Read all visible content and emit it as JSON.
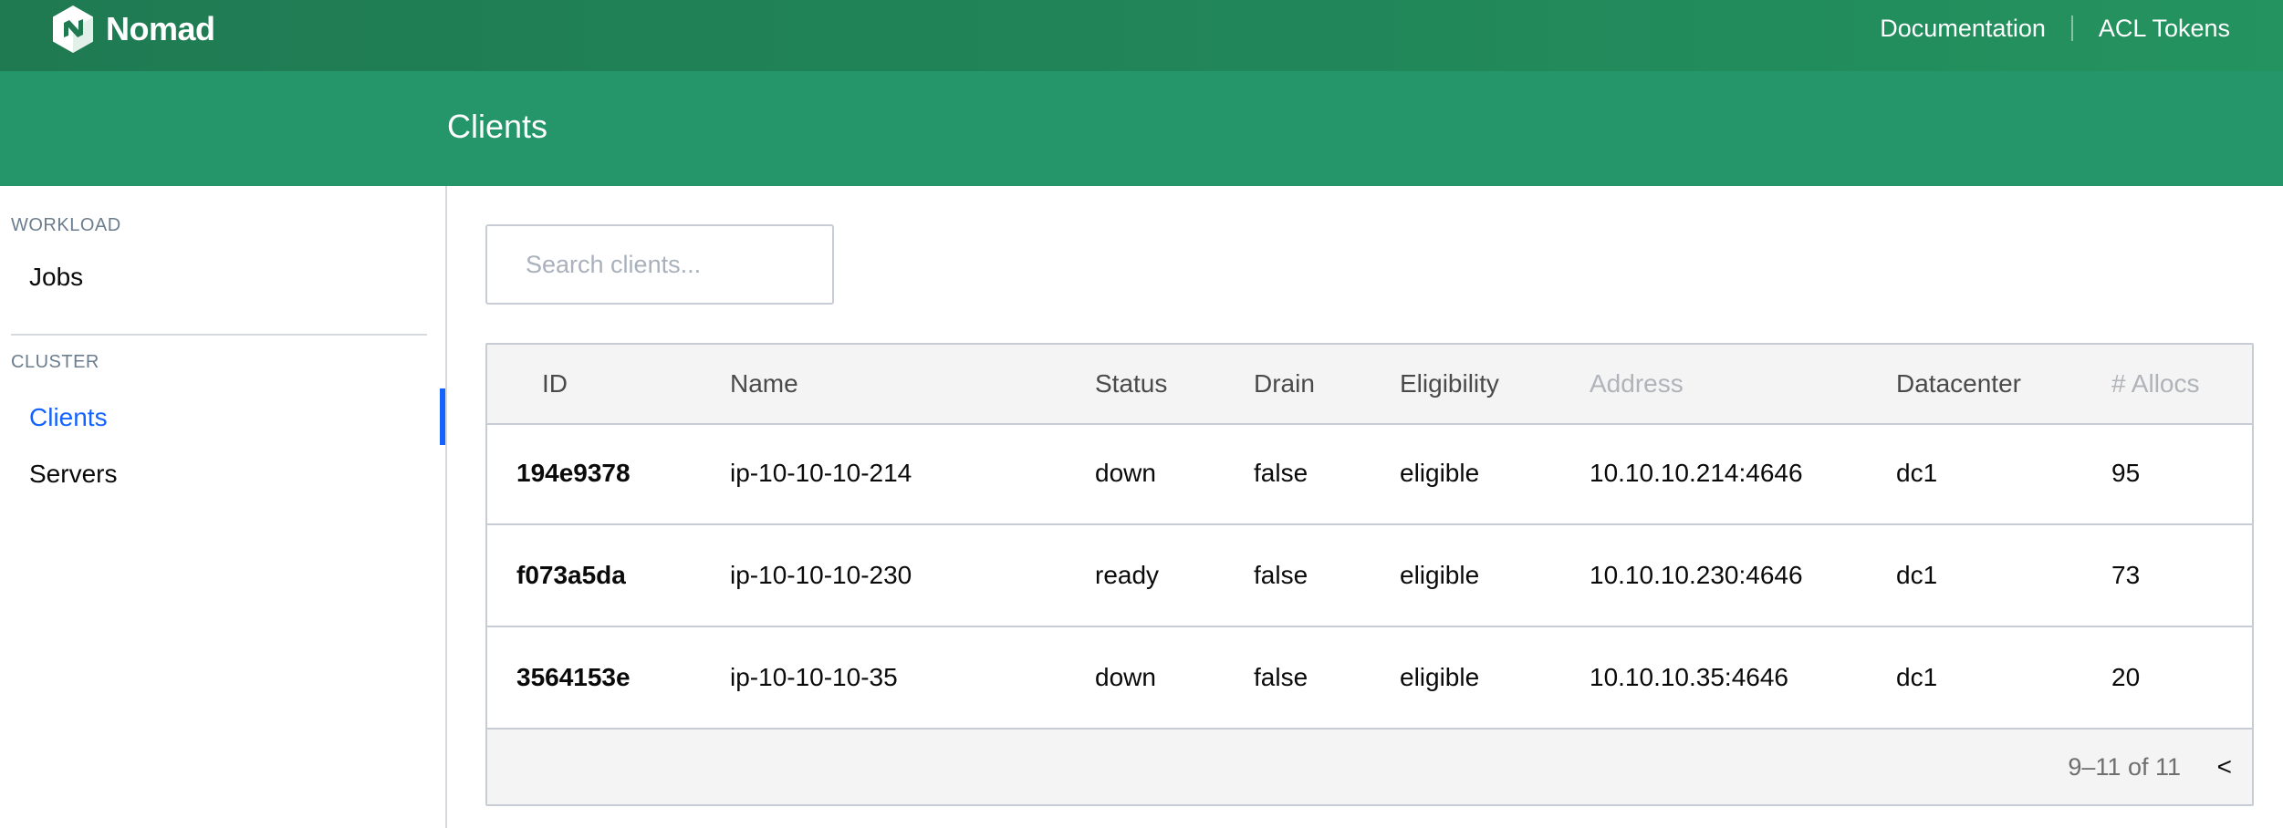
{
  "nav": {
    "brand": "Nomad",
    "logo_icon": "nomad-hexagon-logo",
    "links": [
      "Documentation",
      "ACL Tokens"
    ]
  },
  "page": {
    "title": "Clients"
  },
  "sidebar": {
    "sections": [
      {
        "label": "WORKLOAD",
        "items": [
          {
            "label": "Jobs",
            "active": false
          }
        ]
      },
      {
        "label": "CLUSTER",
        "items": [
          {
            "label": "Clients",
            "active": true
          },
          {
            "label": "Servers",
            "active": false
          }
        ]
      }
    ]
  },
  "search": {
    "placeholder": "Search clients...",
    "value": ""
  },
  "table": {
    "columns": [
      "ID",
      "Name",
      "Status",
      "Drain",
      "Eligibility",
      "Address",
      "Datacenter",
      "# Allocs"
    ],
    "rows": [
      {
        "id": "194e9378",
        "name": "ip-10-10-10-214",
        "status": "down",
        "drain": "false",
        "eligibility": "eligible",
        "address": "10.10.10.214:4646",
        "datacenter": "dc1",
        "allocs": "95"
      },
      {
        "id": "f073a5da",
        "name": "ip-10-10-10-230",
        "status": "ready",
        "drain": "false",
        "eligibility": "eligible",
        "address": "10.10.10.230:4646",
        "datacenter": "dc1",
        "allocs": "73"
      },
      {
        "id": "3564153e",
        "name": "ip-10-10-10-35",
        "status": "down",
        "drain": "false",
        "eligibility": "eligible",
        "address": "10.10.10.35:4646",
        "datacenter": "dc1",
        "allocs": "20"
      }
    ]
  },
  "pagination": {
    "range": "9–11 of 11",
    "prev_label": "<"
  },
  "colors": {
    "nav_green": "#1f7a52",
    "title_green": "#25956a",
    "accent_blue": "#1563ff",
    "muted_text": "#b0b3b8"
  }
}
